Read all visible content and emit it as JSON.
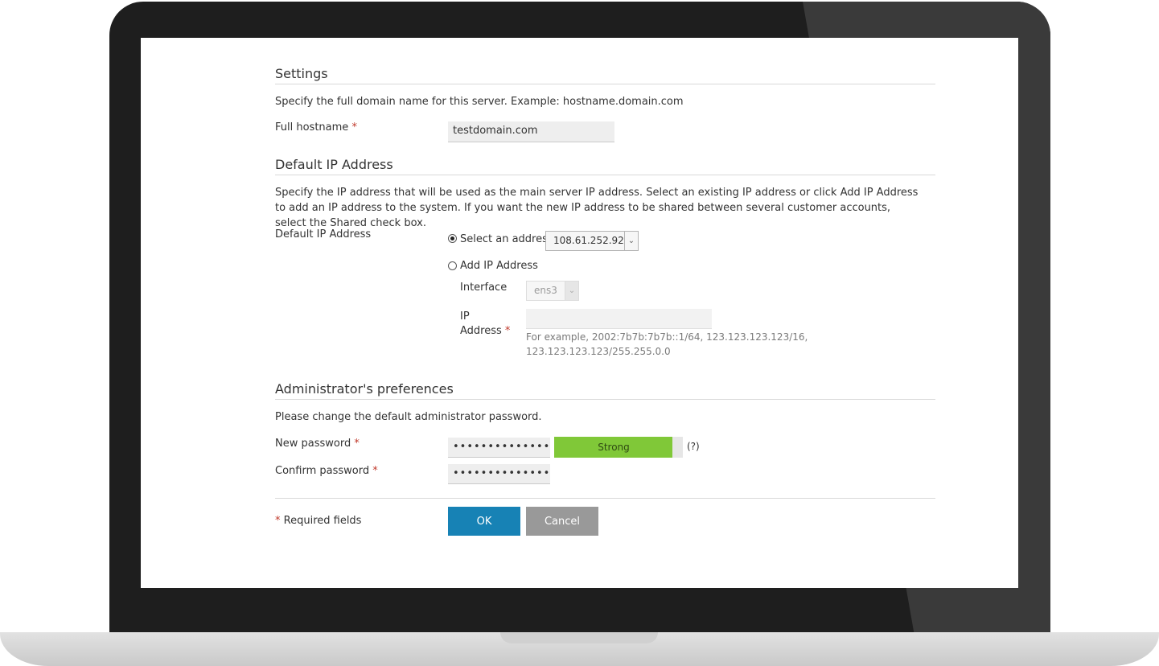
{
  "settings": {
    "title": "Settings",
    "description": "Specify the full domain name for this server. Example: hostname.domain.com",
    "hostname_label": "Full hostname",
    "hostname_value": "testdomain.com"
  },
  "ip": {
    "title": "Default IP Address",
    "description": "Specify the IP address that will be used as the main server IP address. Select an existing IP address or click Add IP Address to add an IP address to the system. If you want the new IP address to be shared between several customer accounts, select the Shared check box.",
    "field_label": "Default IP Address",
    "select_option_label": "Select an address",
    "selected_address": "108.61.252.92",
    "add_option_label": "Add IP Address",
    "interface_label": "Interface",
    "interface_value": "ens3",
    "ip_label_line1": "IP",
    "ip_label_line2": "Address",
    "ip_value": "",
    "ip_hint_line1": "For example, 2002:7b7b:7b7b::1/64, 123.123.123.123/16,",
    "ip_hint_line2": "123.123.123.123/255.255.0.0"
  },
  "admin": {
    "title": "Administrator's preferences",
    "description": "Please change the default administrator password.",
    "new_password_label": "New password",
    "new_password_value": "••••••••••••••",
    "strength_label": "Strong",
    "strength_level": 0.92,
    "help_label": "(?)",
    "confirm_password_label": "Confirm password",
    "confirm_password_value": "••••••••••••••"
  },
  "footer": {
    "required_note": "Required fields",
    "ok_label": "OK",
    "cancel_label": "Cancel"
  },
  "required_marker": "*",
  "colors": {
    "ok_button": "#1782b5",
    "cancel_button": "#999999",
    "strength_fill": "#80c838",
    "required": "#c0392b"
  }
}
